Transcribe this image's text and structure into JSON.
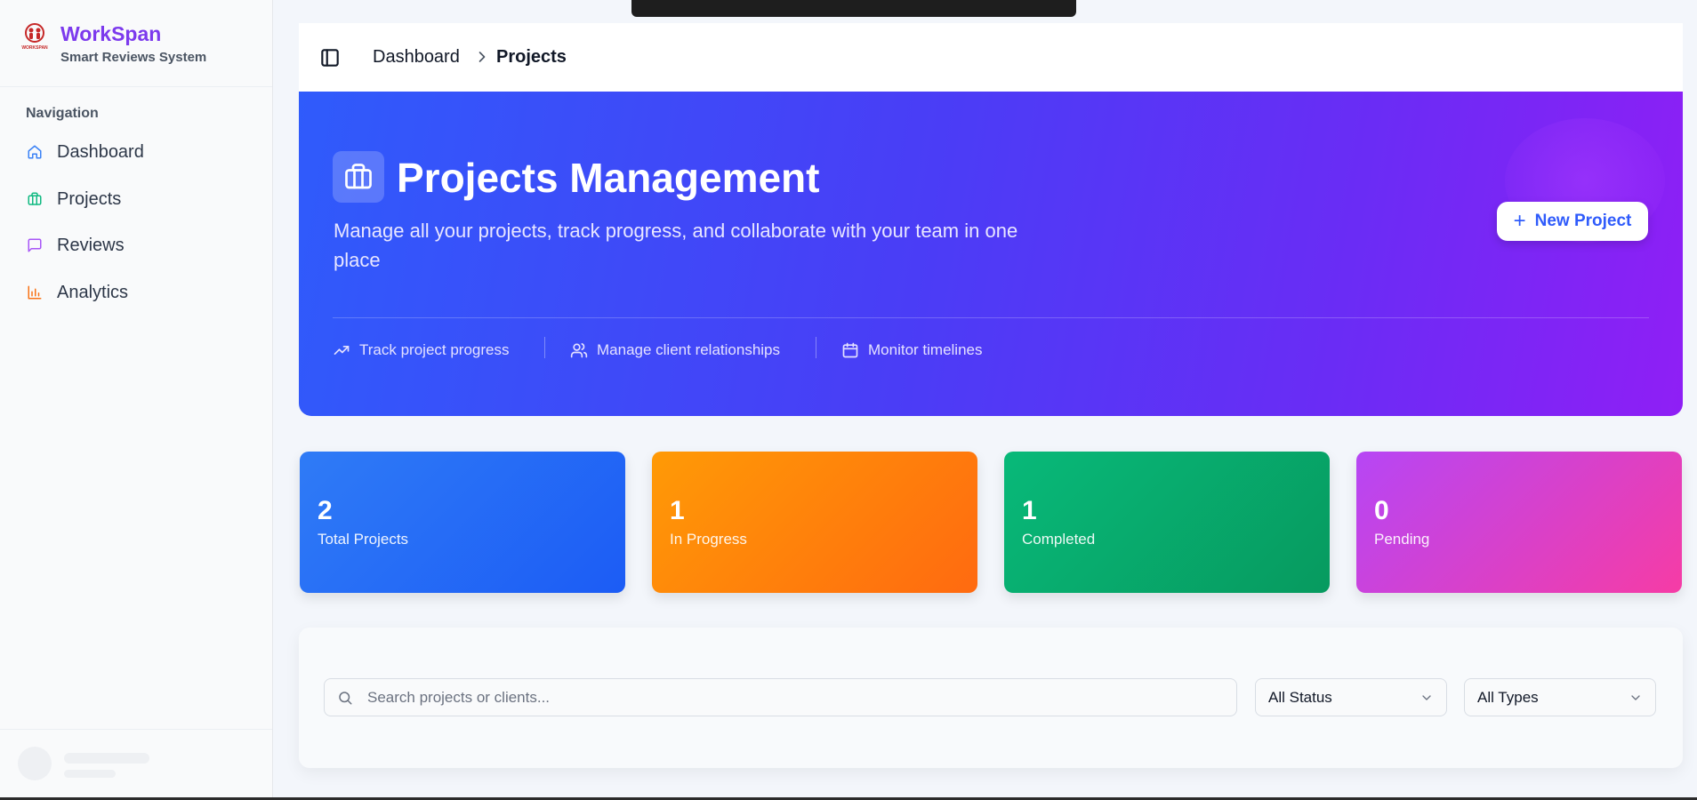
{
  "brand": {
    "name": "WorkSpan",
    "subtitle": "Smart Reviews System",
    "logo_text": "WORKSPAN"
  },
  "sidebar": {
    "heading": "Navigation",
    "items": [
      {
        "label": "Dashboard",
        "icon": "home-icon",
        "color": "#3b82f6"
      },
      {
        "label": "Projects",
        "icon": "briefcase-icon",
        "color": "#10b981"
      },
      {
        "label": "Reviews",
        "icon": "message-square-icon",
        "color": "#a855f7"
      },
      {
        "label": "Analytics",
        "icon": "bar-chart-icon",
        "color": "#f97316"
      }
    ]
  },
  "header": {
    "breadcrumb": [
      "Dashboard",
      "Projects"
    ]
  },
  "hero": {
    "title": "Projects Management",
    "description": "Manage all your projects, track progress, and collaborate with your team in one place",
    "new_button": "New Project",
    "features": [
      {
        "label": "Track project progress",
        "icon": "trending-up-icon"
      },
      {
        "label": "Manage client relationships",
        "icon": "users-icon"
      },
      {
        "label": "Monitor timelines",
        "icon": "calendar-icon"
      }
    ]
  },
  "stats": [
    {
      "value": "2",
      "label": "Total Projects",
      "color": "#1c5cf5"
    },
    {
      "value": "1",
      "label": "In Progress",
      "color": "#ff7a0a"
    },
    {
      "value": "1",
      "label": "Completed",
      "color": "#07a868"
    },
    {
      "value": "0",
      "label": "Pending",
      "color": "#d43fd0"
    }
  ],
  "filters": {
    "search_placeholder": "Search projects or clients...",
    "status_value": "All Status",
    "type_value": "All Types"
  }
}
